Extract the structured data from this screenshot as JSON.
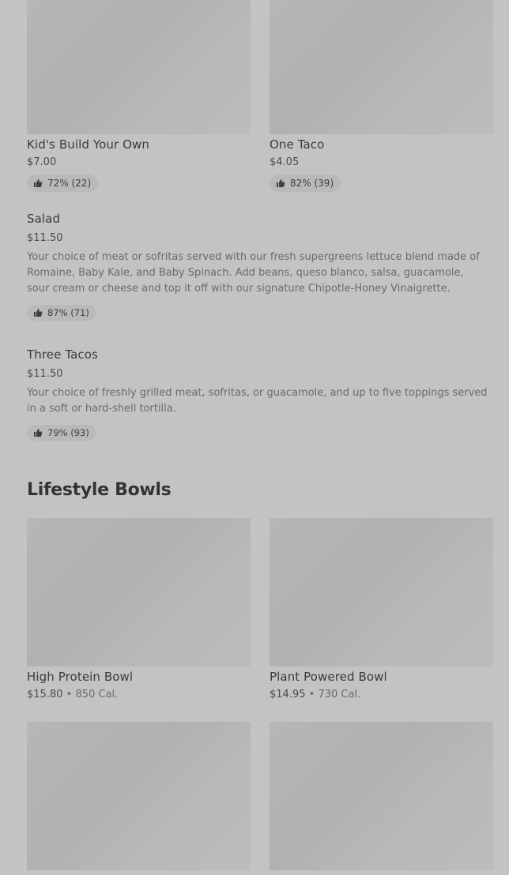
{
  "top_cards": [
    {
      "name": "Kid's Build Your Own",
      "price": "$7.00",
      "rating": "72% (22)"
    },
    {
      "name": "One Taco",
      "price": "$4.05",
      "rating": "82% (39)"
    }
  ],
  "list_items": [
    {
      "name": "Salad",
      "price": "$11.50",
      "description": "Your choice of meat or sofritas served with our fresh supergreens lettuce blend made of Romaine, Baby Kale, and Baby Spinach. Add beans, queso blanco, salsa, guacamole, sour cream or cheese and top it off with our signature Chipotle-Honey Vinaigrette.",
      "rating": "87% (71)"
    },
    {
      "name": "Three Tacos",
      "price": "$11.50",
      "description": "Your choice of freshly grilled meat, sofritas, or guacamole, and up to five toppings served in a soft or hard-shell tortilla.",
      "rating": "79% (93)"
    }
  ],
  "section": {
    "title": "Lifestyle Bowls",
    "cards": [
      {
        "name": "High Protein Bowl",
        "price": "$15.80",
        "separator": "•",
        "calories": "850 Cal."
      },
      {
        "name": "Plant Powered Bowl",
        "price": "$14.95",
        "separator": "•",
        "calories": "730 Cal."
      }
    ]
  },
  "icons": {
    "rating": "thumbs-up-icon"
  }
}
